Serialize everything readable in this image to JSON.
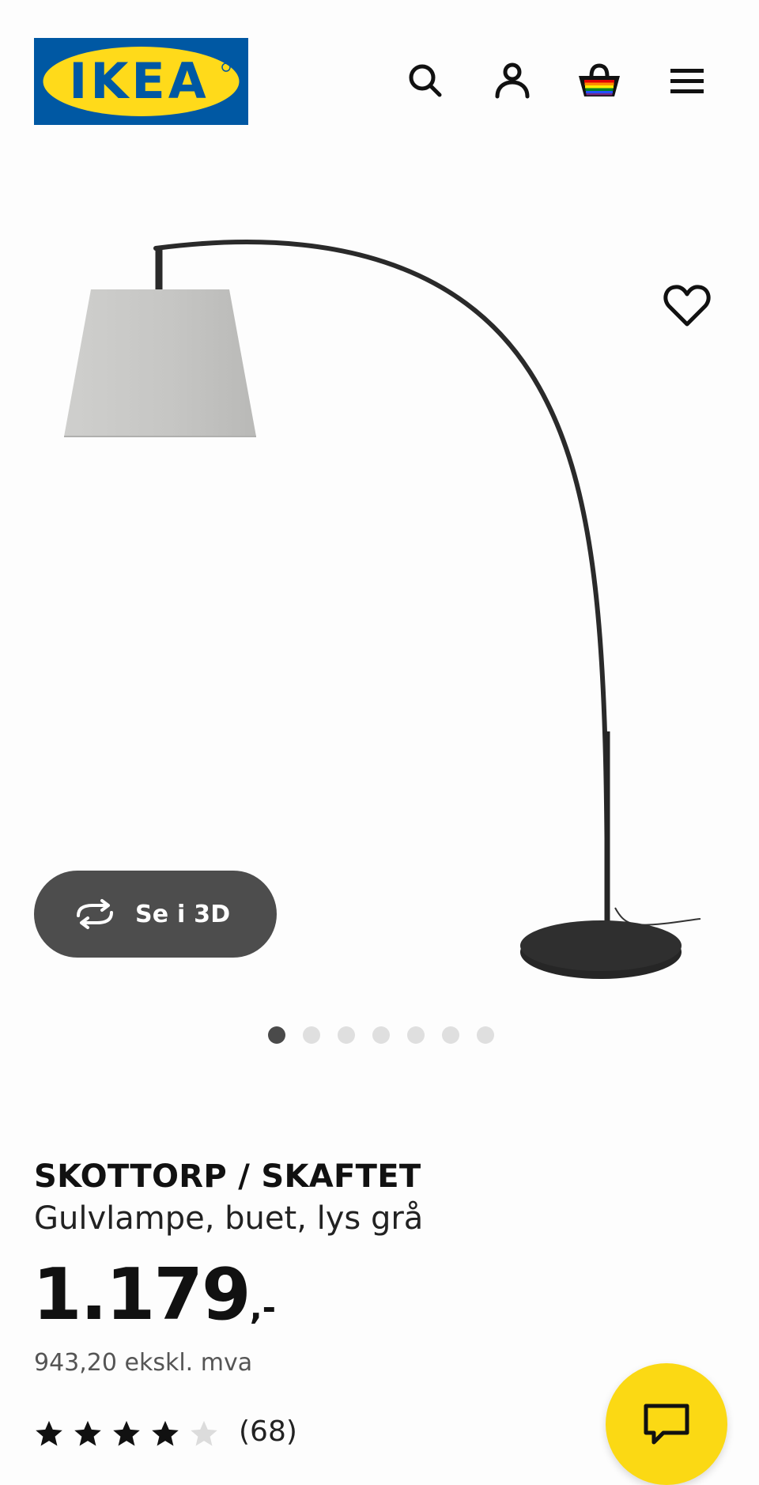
{
  "header": {
    "logo_text": "IKEA",
    "icons": [
      "search-icon",
      "user-icon",
      "basket-icon",
      "menu-icon"
    ],
    "brand_blue": "#0058a3",
    "brand_yellow": "#ffda1a"
  },
  "gallery": {
    "view_3d_label": "Se i 3D",
    "slide_count": 7,
    "active_slide": 1
  },
  "product": {
    "name": "SKOTTORP / SKAFTET",
    "description": "Gulvlampe, buet, lys grå",
    "price_main": "1.179",
    "price_suffix": ",-",
    "price_ex_vat": "943,20 ekskl. mva",
    "rating": 4,
    "rating_max": 5,
    "review_count": "(68)"
  },
  "chat": {
    "icon": "chat-icon",
    "color": "#fbd914"
  }
}
